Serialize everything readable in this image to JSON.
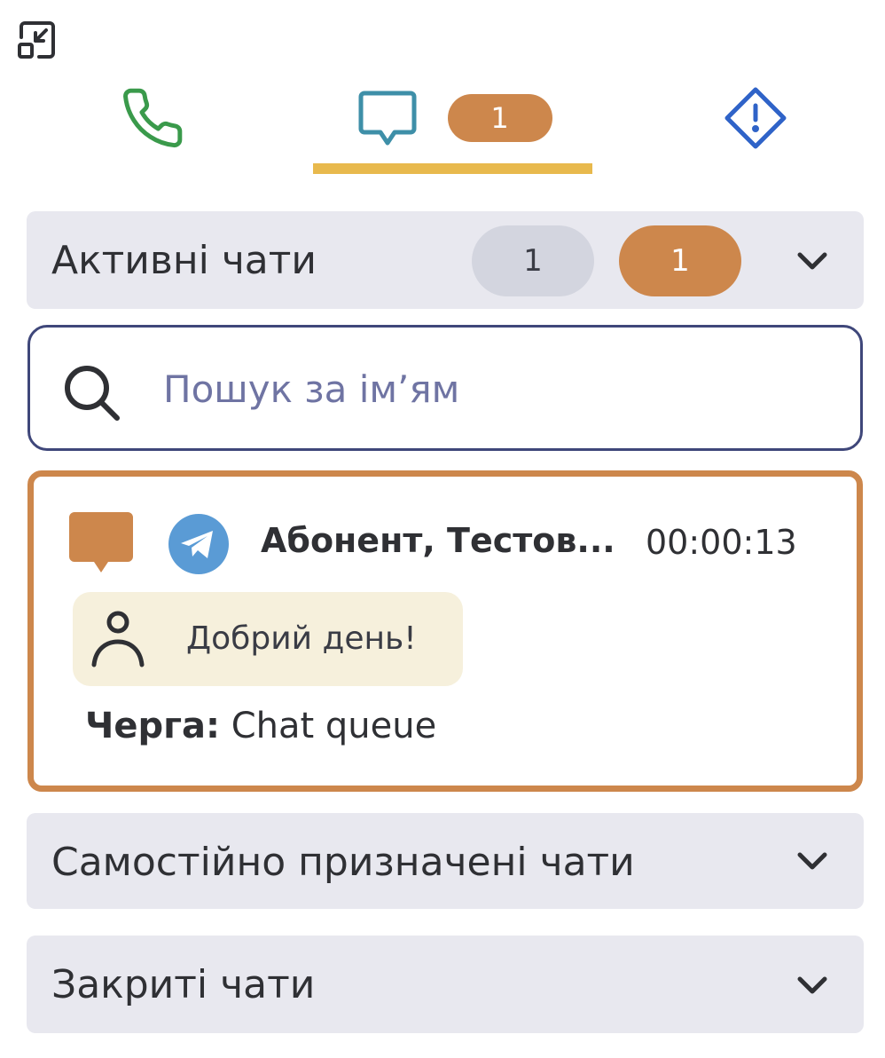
{
  "colors": {
    "accent_orange": "#cd874c",
    "tab_underline": "#e8b94d",
    "phone_icon": "#3a9a4b",
    "chat_icon": "#3e8fa8",
    "alert_icon": "#2f63c8",
    "section_bg": "#e8e8ef",
    "message_bg": "#f6f0dc",
    "search_border": "#3f477a"
  },
  "toolbar": {
    "minimize_icon": "minimize-window-icon"
  },
  "tabs": [
    {
      "id": "calls",
      "icon": "phone-icon"
    },
    {
      "id": "chats",
      "icon": "chat-bubble-icon",
      "badge": "1",
      "active": true
    },
    {
      "id": "alerts",
      "icon": "alert-diamond-icon"
    }
  ],
  "sections": {
    "active": {
      "title": "Активні чати",
      "count_total": "1",
      "count_unread": "1",
      "icon": "chevron-down-icon"
    },
    "self_assigned": {
      "title": "Самостійно призначені чати",
      "icon": "chevron-down-icon"
    },
    "closed": {
      "title": "Закриті чати",
      "icon": "chevron-down-icon"
    }
  },
  "search": {
    "placeholder": "Пошук за ім’ям",
    "value": "",
    "icon": "search-icon"
  },
  "chat": {
    "channel_icon": "telegram-icon",
    "status_icon": "chat-bubble-icon",
    "contact_name": "Абонент, Тестов...",
    "timer": "00:00:13",
    "last_message": "Добрий день!",
    "sender_icon": "person-icon",
    "queue_label": "Черга:",
    "queue_value": "Chat queue"
  }
}
